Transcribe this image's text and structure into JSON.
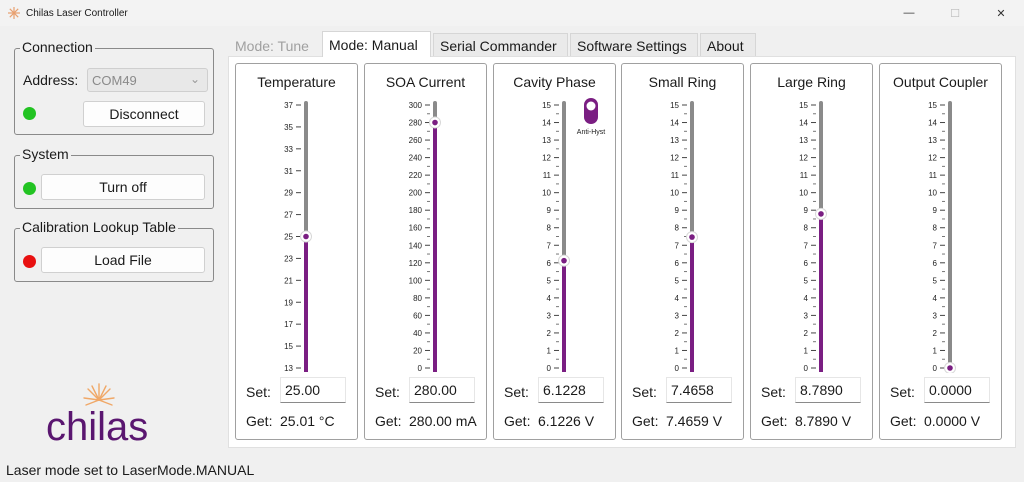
{
  "window": {
    "title": "Chilas Laser Controller",
    "controls": {
      "minimize": "—",
      "maximize": "☐",
      "close": "✕"
    }
  },
  "connection": {
    "title": "Connection",
    "address_label": "Address:",
    "address_value": "COM49",
    "status_color": "#22c322",
    "disconnect_label": "Disconnect"
  },
  "system": {
    "title": "System",
    "status_color": "#22c322",
    "turn_off_label": "Turn off"
  },
  "calibration": {
    "title": "Calibration Lookup Table",
    "status_color": "#e81010",
    "load_label": "Load File"
  },
  "tabs": [
    {
      "label": "Mode: Tune",
      "state": "disabled"
    },
    {
      "label": "Mode: Manual",
      "state": "active"
    },
    {
      "label": "Serial Commander",
      "state": "normal"
    },
    {
      "label": "Software Settings",
      "state": "normal"
    },
    {
      "label": "About",
      "state": "normal"
    }
  ],
  "labels": {
    "set": "Set:",
    "get": "Get:"
  },
  "accent_color": "#7a1e82",
  "channels": [
    {
      "id": "temperature",
      "title": "Temperature",
      "ticks": [
        "13",
        "15",
        "17",
        "19",
        "21",
        "23",
        "25",
        "27",
        "29",
        "31",
        "33",
        "35",
        "37"
      ],
      "min": 13,
      "max": 37,
      "value": 25.0,
      "set": "25.00",
      "get": "25.01 °C",
      "minor": false,
      "label_step": 1
    },
    {
      "id": "soa",
      "title": "SOA Current",
      "ticks": [
        "0",
        "20",
        "40",
        "60",
        "80",
        "100",
        "120",
        "140",
        "160",
        "180",
        "200",
        "220",
        "240",
        "260",
        "280",
        "300"
      ],
      "min": 0,
      "max": 300,
      "value": 280.0,
      "set": "280.00",
      "get": "280.00 mA",
      "minor": true,
      "label_step": 1
    },
    {
      "id": "phase",
      "title": "Cavity Phase",
      "ticks": [
        "0",
        "1",
        "2",
        "3",
        "4",
        "5",
        "6",
        "7",
        "8",
        "9",
        "10",
        "11",
        "12",
        "13",
        "14",
        "15"
      ],
      "min": 0,
      "max": 15,
      "value": 6.1228,
      "set": "6.1228",
      "get": "6.1226 V",
      "minor": true,
      "label_step": 1,
      "toggle_label": "Anti-Hyst"
    },
    {
      "id": "small_ring",
      "title": "Small Ring",
      "ticks": [
        "0",
        "1",
        "2",
        "3",
        "4",
        "5",
        "6",
        "7",
        "8",
        "9",
        "10",
        "11",
        "12",
        "13",
        "14",
        "15"
      ],
      "min": 0,
      "max": 15,
      "value": 7.4658,
      "set": "7.4658",
      "get": "7.4659 V",
      "minor": true,
      "label_step": 1
    },
    {
      "id": "large_ring",
      "title": "Large Ring",
      "ticks": [
        "0",
        "1",
        "2",
        "3",
        "4",
        "5",
        "6",
        "7",
        "8",
        "9",
        "10",
        "11",
        "12",
        "13",
        "14",
        "15"
      ],
      "min": 0,
      "max": 15,
      "value": 8.789,
      "set": "8.7890",
      "get": "8.7890 V",
      "minor": true,
      "label_step": 1
    },
    {
      "id": "output_coupler",
      "title": "Output Coupler",
      "ticks": [
        "0",
        "1",
        "2",
        "3",
        "4",
        "5",
        "6",
        "7",
        "8",
        "9",
        "10",
        "11",
        "12",
        "13",
        "14",
        "15"
      ],
      "min": 0,
      "max": 15,
      "value": 0.0,
      "set": "0.0000",
      "get": "0.0000 V",
      "minor": true,
      "label_step": 1
    }
  ],
  "logo": {
    "text": "chilas"
  },
  "status": "Laser mode set to LaserMode.MANUAL"
}
